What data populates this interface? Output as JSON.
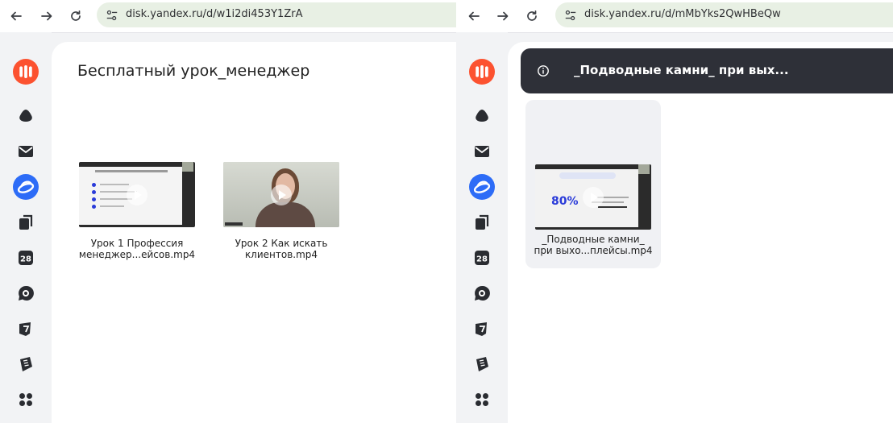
{
  "left": {
    "url": "disk.yandex.ru/d/w1i2di453Y1ZrA",
    "folder_title": "Бесплатный урок_менеджер",
    "files": [
      {
        "name_line1": "Урок 1 Профессия",
        "name_line2": "менеджер...ейсов.mp4"
      },
      {
        "name_line1": "Урок 2 Как искать",
        "name_line2": "клиентов.mp4"
      }
    ]
  },
  "right": {
    "url": "disk.yandex.ru/d/mMbYks2QwHBeQw",
    "banner_title": "_Подводные камни_ при вых...",
    "files": [
      {
        "name_line1": "_Подводные камни_",
        "name_line2": "при выхо...плейсы.mp4",
        "thumb_figure": "80%"
      }
    ]
  },
  "rail_icons": [
    "yandex-logo-icon",
    "cloud-icon",
    "mail-icon",
    "disk-icon",
    "documents-icon",
    "calendar-icon",
    "messenger-icon",
    "telemost-icon",
    "notes-icon",
    "apps-grid-icon"
  ],
  "rail_calendar_day": "28",
  "colors": {
    "brand": "#fc5230",
    "accent_blue": "#2d6cf7",
    "dark_banner": "#2e3038"
  }
}
